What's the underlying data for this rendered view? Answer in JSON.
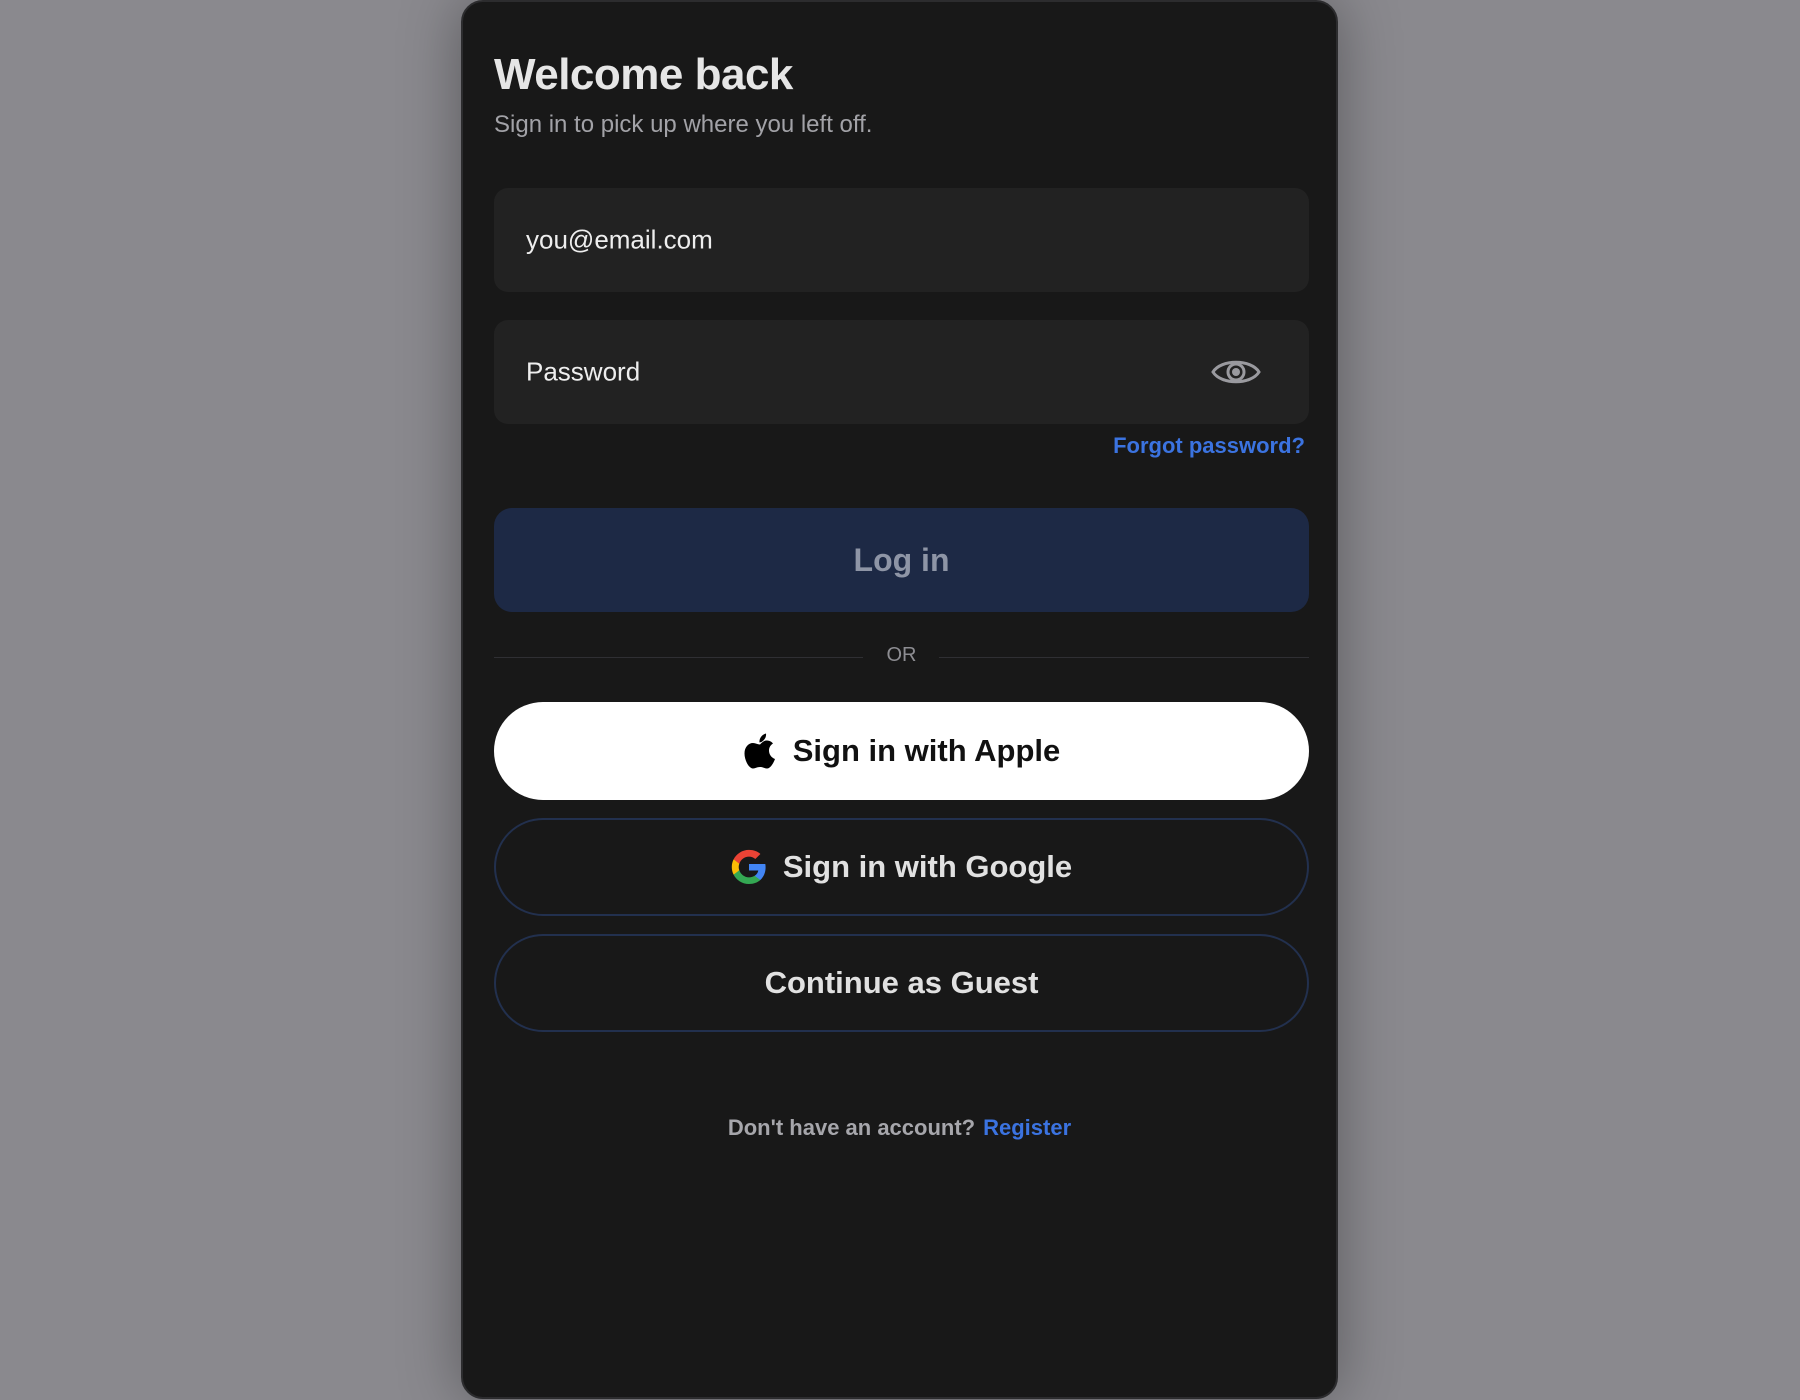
{
  "header": {
    "title": "Welcome back",
    "subtitle": "Sign in to pick up where you left off."
  },
  "form": {
    "email_placeholder": "you@email.com",
    "password_placeholder": "Password",
    "show_password_icon": "eye-icon",
    "forgot_label": "Forgot password?",
    "login_label": "Log in"
  },
  "divider": {
    "label": "OR"
  },
  "social": {
    "apple_label": "Sign in with Apple",
    "apple_icon": "apple-icon",
    "google_label": "Sign in with Google",
    "google_icon": "google-icon",
    "guest_label": "Continue as Guest"
  },
  "footer": {
    "prompt": "Don't have an account?",
    "register_label": "Register"
  },
  "colors": {
    "background": "#8a898e",
    "card": "#181818",
    "field": "#222222",
    "primary_button": "#1d2945",
    "link": "#3b73e0",
    "apple_button": "#ffffff",
    "outline": "#22304e"
  }
}
